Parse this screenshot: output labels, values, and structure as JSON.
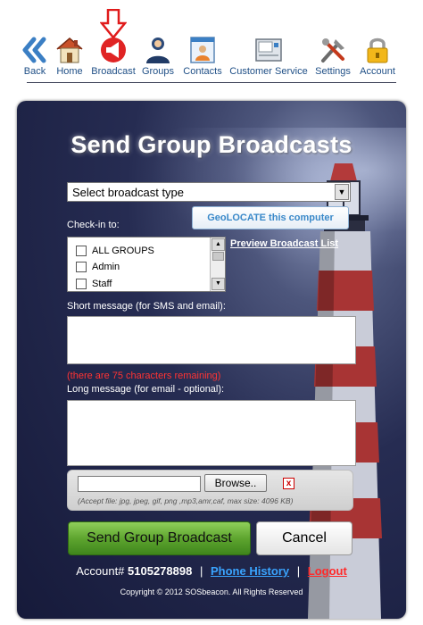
{
  "nav": {
    "items": [
      {
        "label": "Back",
        "icon": "back-icon"
      },
      {
        "label": "Home",
        "icon": "home-icon"
      },
      {
        "label": "Broadcast",
        "icon": "broadcast-icon"
      },
      {
        "label": "Groups",
        "icon": "groups-icon"
      },
      {
        "label": "Contacts",
        "icon": "contacts-icon"
      },
      {
        "label": "Customer Service",
        "icon": "customer-service-icon"
      },
      {
        "label": "Settings",
        "icon": "settings-icon"
      },
      {
        "label": "Account",
        "icon": "account-icon"
      }
    ],
    "indicator_icon": "down-arrow-icon",
    "colors": {
      "label": "#1f4f86",
      "indicator": "#e01b1b"
    }
  },
  "panel": {
    "title": "Send Group Broadcasts",
    "broadcast_type": {
      "selected": "Select broadcast type"
    },
    "geolocate_label": "GeoLOCATE this computer",
    "checkin_label": "Check-in to:",
    "groups": [
      "ALL GROUPS",
      "Admin",
      "Staff"
    ],
    "preview_link": "Preview Broadcast List",
    "short_label": "Short message (for SMS and email):",
    "short_value": "",
    "remaining_text": "(there are 75 characters remaining)",
    "long_label": "Long message (for email - optional):",
    "long_value": "",
    "attachment": {
      "value": "",
      "browse_label": "Browse..",
      "remove_label": "x",
      "accept_note": "(Accept file: jpg, jpeg, gif, png ,mp3,amr,caf, max size: 4096 KB)"
    },
    "send_label": "Send Group Broadcast",
    "cancel_label": "Cancel",
    "account_prefix": "Account#",
    "account_number": "5105278898",
    "separator": "|",
    "phone_history": "Phone History",
    "logout": "Logout",
    "copyright": "Copyright © 2012 SOSbeacon. All Rights Reserved",
    "colors": {
      "send": "#5ea52f",
      "remaining": "#ff3333",
      "phone_link": "#3aa4ff",
      "logout": "#ff2a2a",
      "geo": "#3a89c9"
    }
  }
}
